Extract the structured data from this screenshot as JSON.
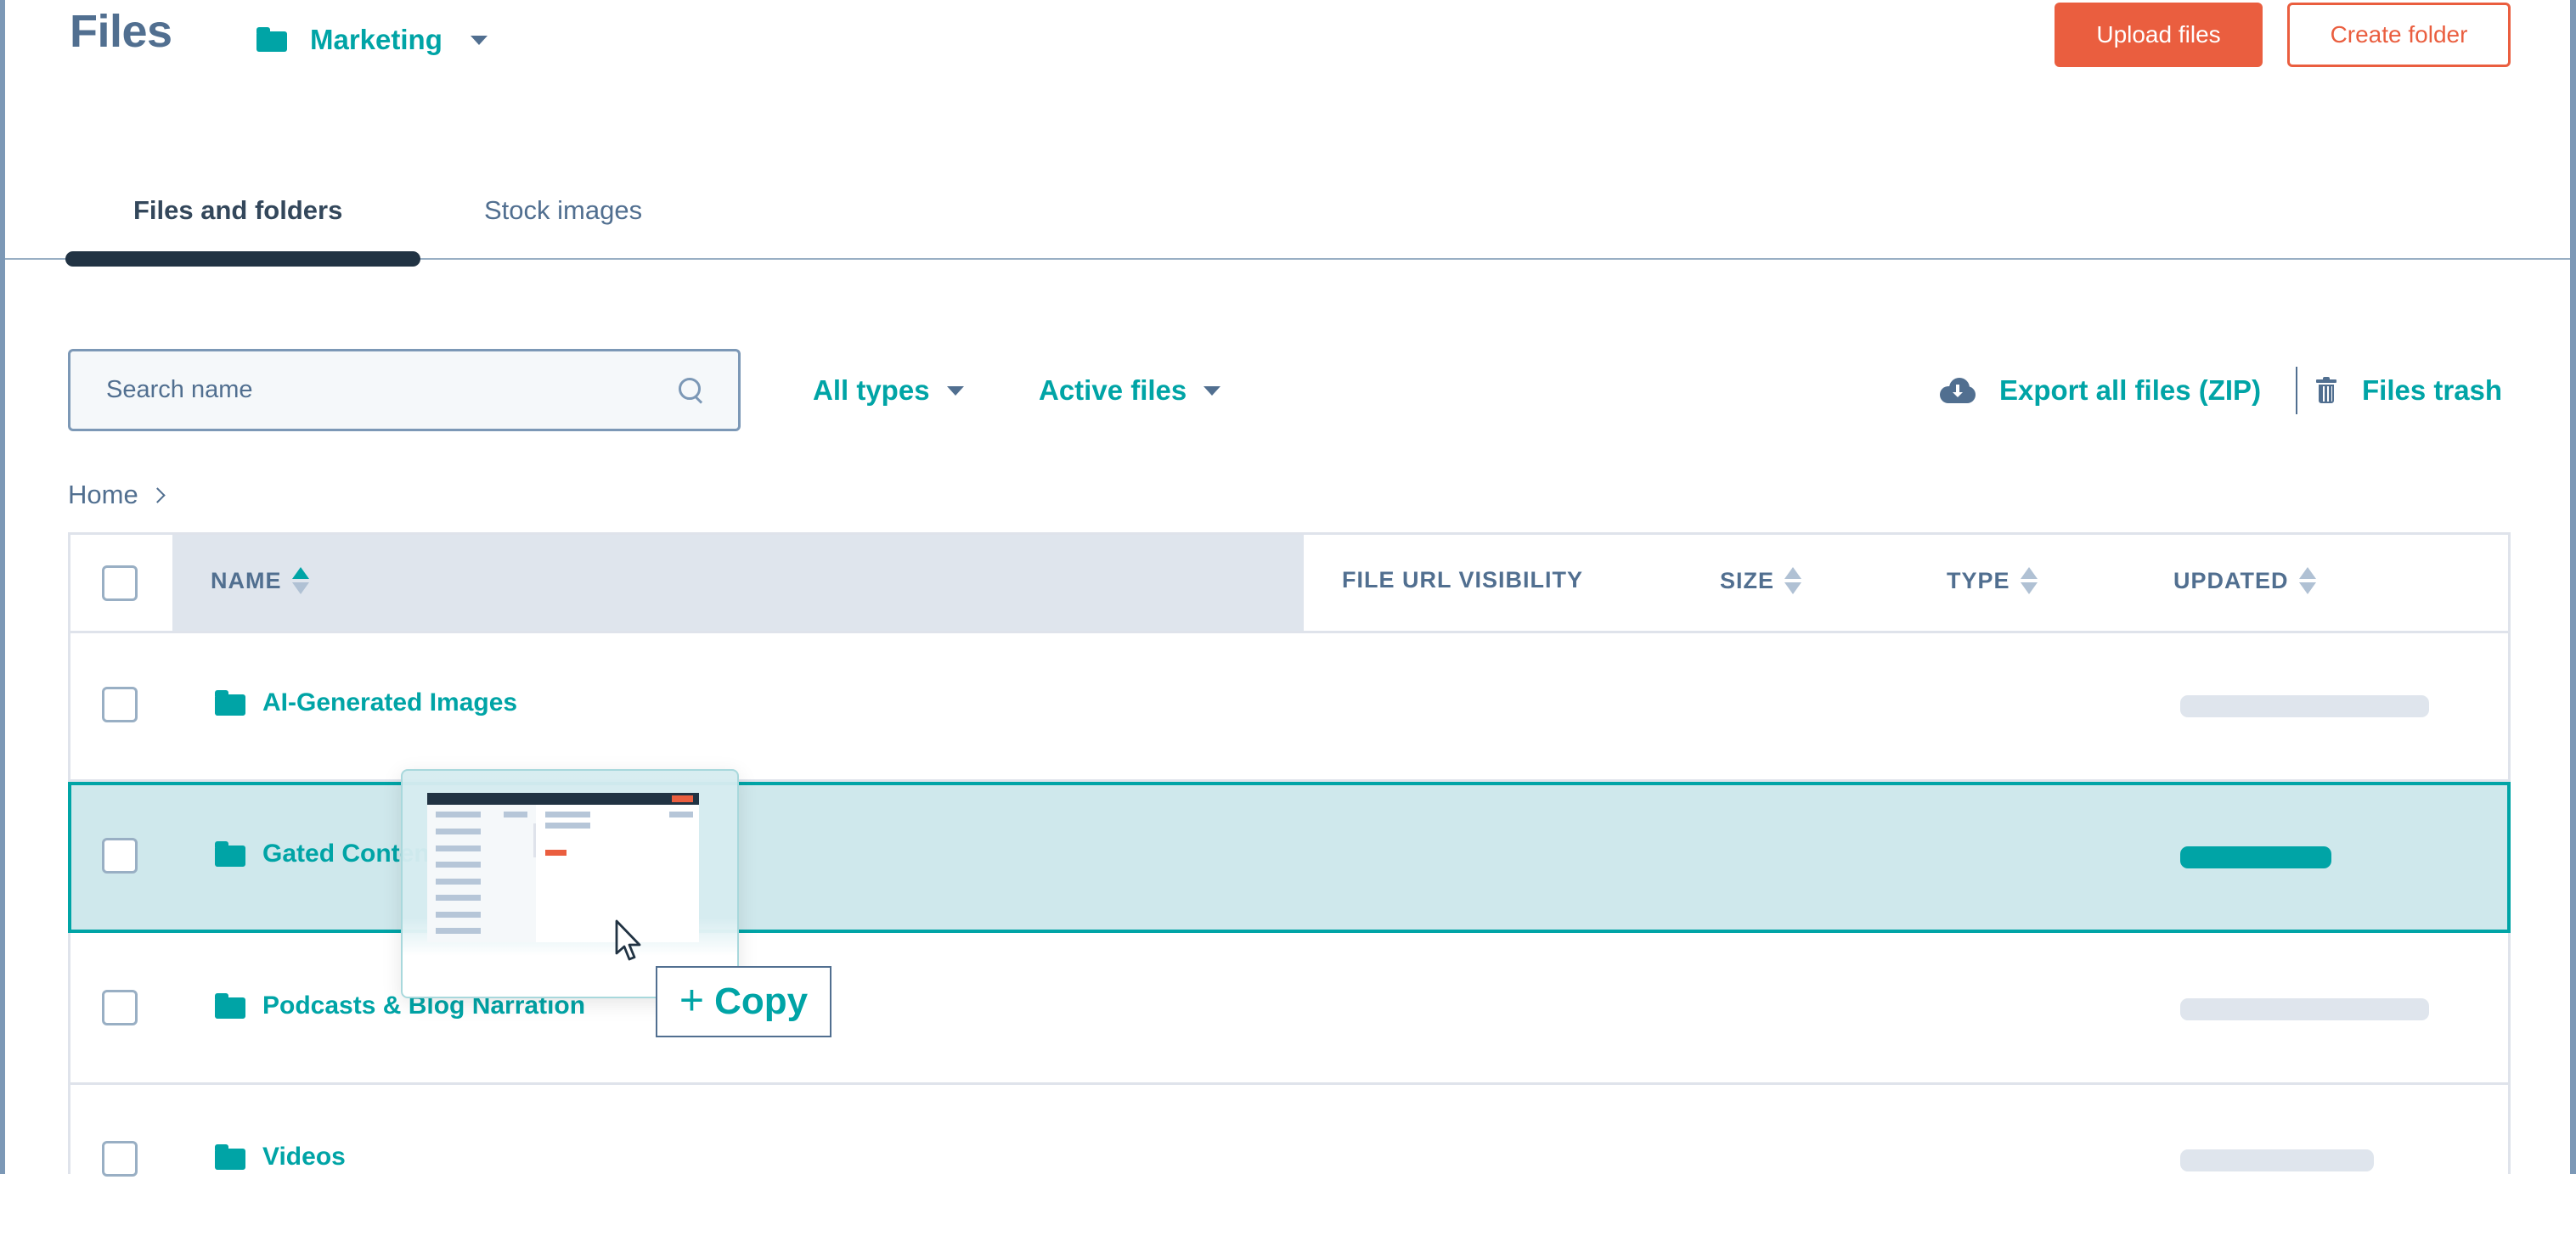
{
  "header": {
    "title": "Files",
    "folder_switcher": {
      "icon": "folder-icon",
      "label": "Marketing"
    },
    "upload_button": "Upload files",
    "create_folder_button": "Create folder"
  },
  "tabs": [
    {
      "label": "Files and folders",
      "active": true
    },
    {
      "label": "Stock images",
      "active": false
    }
  ],
  "toolbar": {
    "search": {
      "placeholder": "Search name",
      "value": ""
    },
    "type_filter": "All types",
    "status_filter": "Active files",
    "export_label": "Export all files (ZIP)",
    "trash_label": "Files trash"
  },
  "breadcrumb": {
    "items": [
      "Home"
    ]
  },
  "table": {
    "columns": [
      {
        "label": "NAME",
        "sort": "ascending"
      },
      {
        "label": "FILE URL VISIBILITY",
        "sort": null
      },
      {
        "label": "SIZE",
        "sort": "none"
      },
      {
        "label": "TYPE",
        "sort": "none"
      },
      {
        "label": "UPDATED",
        "sort": "none"
      }
    ],
    "rows": [
      {
        "name": "AI-Generated Images",
        "type": "folder",
        "selected": false,
        "updated": "loading"
      },
      {
        "name": "Gated Content",
        "type": "folder",
        "selected": true,
        "updated": "loading"
      },
      {
        "name": "Podcasts & Blog Narration",
        "type": "folder",
        "selected": false,
        "updated": "loading"
      },
      {
        "name": "Videos",
        "type": "folder",
        "selected": false,
        "updated": "loading"
      }
    ]
  },
  "drag": {
    "drop_action": "Copy",
    "drop_action_prefix": "+"
  },
  "colors": {
    "accent_teal": "#00a4a6",
    "primary_orange": "#ea5e3f",
    "text_slate": "#516f90",
    "dark_navy": "#213343",
    "selected_row_bg": "#cfe8ec"
  }
}
